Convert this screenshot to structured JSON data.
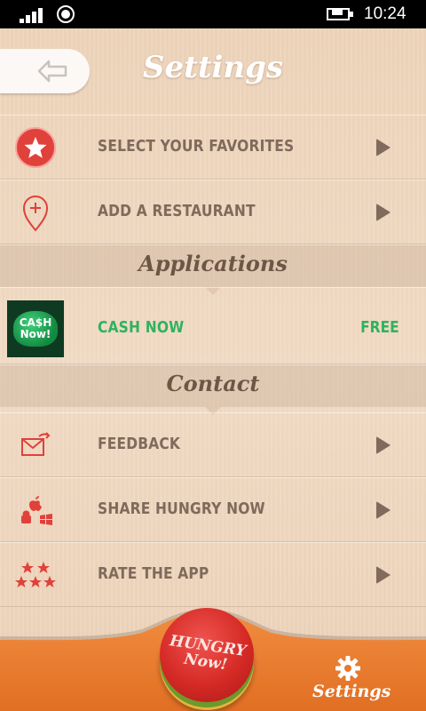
{
  "status_bar": {
    "time": "10:24",
    "icons": [
      "signal-icon",
      "data-icon",
      "battery-charging-icon"
    ]
  },
  "header": {
    "title": "Settings",
    "back_icon": "back-arrow-icon"
  },
  "menu_items": [
    {
      "label": "SELECT YOUR FAVORITES",
      "icon": "star-icon"
    },
    {
      "label": "ADD A RESTAURANT",
      "icon": "location-add-icon"
    }
  ],
  "sections": {
    "applications": {
      "title": "Applications",
      "apps": [
        {
          "name": "CASH NOW",
          "price": "FREE",
          "icon_text": "CA$H Now!"
        }
      ]
    },
    "contact": {
      "title": "Contact",
      "items": [
        {
          "label": "FEEDBACK",
          "icon": "mail-share-icon"
        },
        {
          "label": "SHARE HUNGRY NOW",
          "icon": "platforms-icon"
        },
        {
          "label": "RATE THE APP",
          "icon": "stars-icon"
        }
      ]
    }
  },
  "bottom_nav": {
    "main_button": "HUNGRY Now!",
    "settings_label": "Settings",
    "settings_icon": "gear-icon"
  },
  "colors": {
    "accent_red": "#e0413a",
    "text_brown": "#7f6a5c",
    "app_green": "#2fb35e",
    "bar_orange": "#e8792d"
  }
}
